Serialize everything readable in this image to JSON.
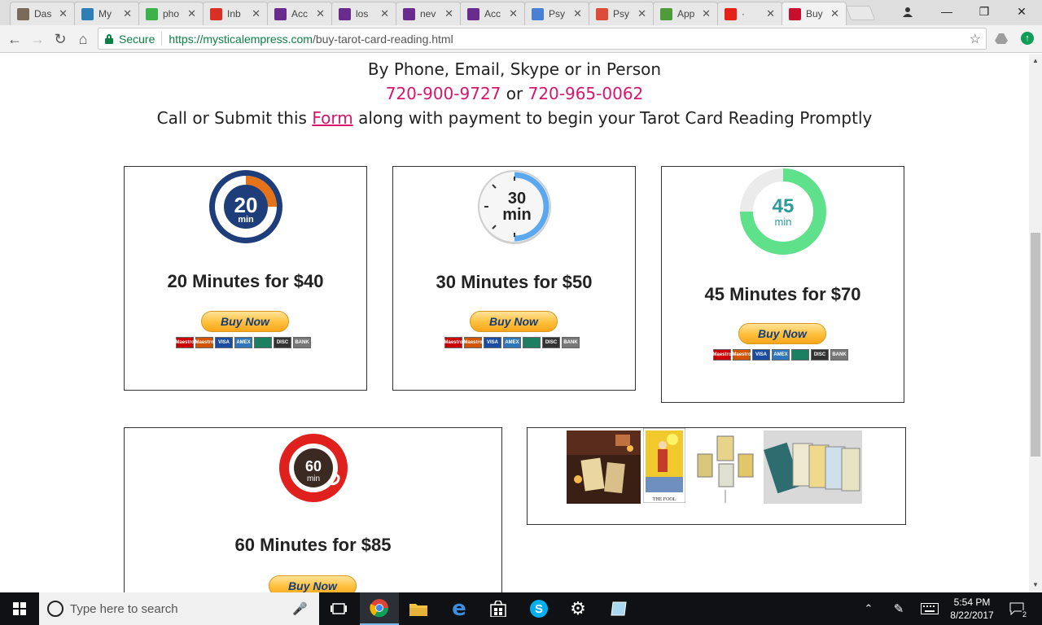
{
  "browser": {
    "tabs": [
      {
        "title": "Das",
        "icon": "photo-favicon",
        "color": "#7a6a5a"
      },
      {
        "title": "My",
        "icon": "w-favicon",
        "color": "#2f7fb5"
      },
      {
        "title": "pho",
        "icon": "play-favicon",
        "color": "#3bb34a"
      },
      {
        "title": "Inb",
        "icon": "gmail-favicon",
        "color": "#d93025"
      },
      {
        "title": "Acc",
        "icon": "peace-favicon",
        "color": "#6a2b8f"
      },
      {
        "title": "los",
        "icon": "peace-favicon",
        "color": "#6a2b8f"
      },
      {
        "title": "nev",
        "icon": "peace-favicon",
        "color": "#6a2b8f"
      },
      {
        "title": "Acc",
        "icon": "peace-favicon",
        "color": "#6a2b8f"
      },
      {
        "title": "Psy",
        "icon": "docs-favicon",
        "color": "#4a7fd6"
      },
      {
        "title": "Psy",
        "icon": "google-plus-favicon",
        "color": "#dd4b39"
      },
      {
        "title": "App",
        "icon": "app-favicon",
        "color": "#4f9a3b"
      },
      {
        "title": "·",
        "icon": "youtube-favicon",
        "color": "#e62117"
      },
      {
        "title": "Buy",
        "icon": "rose-favicon",
        "color": "#c8102e"
      }
    ],
    "url_secure_label": "Secure",
    "url_host": "https://mysticalempress.com",
    "url_path": "/buy-tarot-card-reading.html"
  },
  "page": {
    "line1": "By Phone, Email, Skype or in Person",
    "phone1": "720-900-9727",
    "or": "or",
    "phone2": "720-965-0062",
    "line3_before": "Call or Submit this",
    "form_link": "Form",
    "line3_after": "along with payment to begin your Tarot Card Reading Promptly",
    "cards": [
      {
        "title": "20 Minutes for $40",
        "timer_number": "20",
        "timer_unit": "min",
        "button": "Buy Now"
      },
      {
        "title": "30 Minutes for $50",
        "timer_number": "30",
        "timer_unit": "min",
        "button": "Buy Now"
      },
      {
        "title": "45 Minutes for $70",
        "timer_number": "45",
        "timer_unit": "min",
        "button": "Buy Now"
      },
      {
        "title": "60 Minutes for $85",
        "timer_number": "60",
        "timer_unit": "min",
        "button": "Buy Now"
      }
    ],
    "payment_labels": [
      "Maestro",
      "Maestro",
      "VISA",
      "AMEX",
      "",
      "DISC",
      "BANK"
    ],
    "fool_card_caption": "THE FOOL"
  },
  "taskbar": {
    "search_placeholder": "Type here to search",
    "time": "5:54 PM",
    "date": "8/22/2017",
    "notification_count": "2"
  },
  "colors": {
    "accent_pink": "#d8156b",
    "timer20_navy": "#1e3d7b",
    "timer20_orange": "#e4731a",
    "timer30_blue": "#5aa9f0",
    "timer45_green": "#5fe08a",
    "timer45_text": "#2a9d9a",
    "timer60_red": "#e0201d"
  }
}
